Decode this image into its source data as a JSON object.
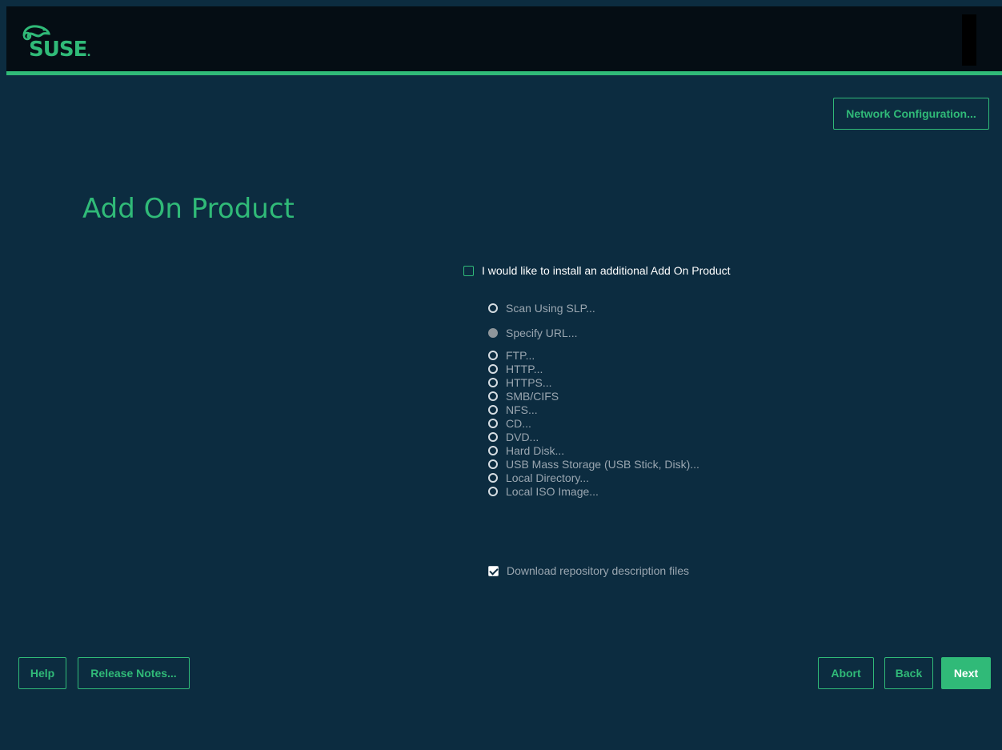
{
  "header": {
    "logo_text": "SUSE"
  },
  "toolbar": {
    "network_config_label": "Network Configuration..."
  },
  "page": {
    "title": "Add On Product"
  },
  "addon": {
    "enable_label": "I would like to install an additional Add On Product",
    "enable_checked": false,
    "download_label": "Download repository description files",
    "download_checked": true
  },
  "sources": {
    "scan_slp": "Scan Using SLP...",
    "specify_url": "Specify URL...",
    "options": [
      "FTP...",
      "HTTP...",
      "HTTPS...",
      "SMB/CIFS",
      "NFS...",
      "CD...",
      "DVD...",
      "Hard Disk...",
      "USB Mass Storage (USB Stick, Disk)...",
      "Local Directory...",
      "Local ISO Image..."
    ],
    "selected": "Specify URL..."
  },
  "footer": {
    "help_label": "Help",
    "release_notes_label": "Release Notes...",
    "abort_label": "Abort",
    "back_label": "Back",
    "next_label": "Next"
  },
  "colors": {
    "background": "#0c2c40",
    "header": "#050d14",
    "accent": "#30ba78",
    "text": "#ffffff",
    "disabled_text": "#9aa6b0"
  }
}
